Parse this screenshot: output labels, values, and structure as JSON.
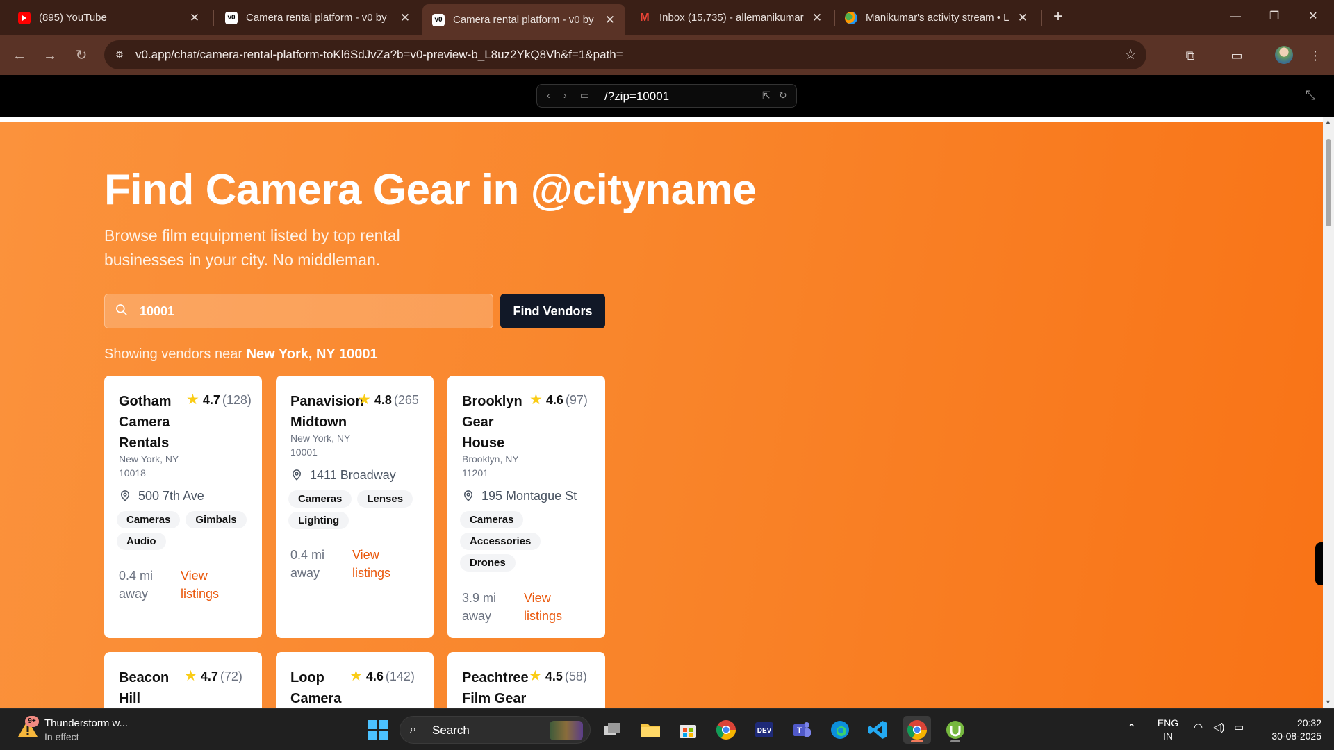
{
  "browser": {
    "tabs": [
      {
        "label": "(895) YouTube",
        "favicon": "youtube-icon"
      },
      {
        "label": "Camera rental platform - v0 by",
        "favicon": "v0-icon"
      },
      {
        "label": "Camera rental platform - v0 by",
        "favicon": "v0-icon",
        "active": true
      },
      {
        "label": "Inbox (15,735) - allemanikumar",
        "favicon": "gmail-icon"
      },
      {
        "label": "Manikumar's activity stream • L",
        "favicon": "linkedin-learning-icon"
      }
    ],
    "new_tab": "+",
    "url": "v0.app/chat/camera-rental-platform-toKl6SdJvZa?b=v0-preview-b_L8uz2YkQ8Vh&f=1&path="
  },
  "preview": {
    "path": "/?zip=10001"
  },
  "page": {
    "title": "Find Camera Gear in @cityname",
    "subtitle": "Browse film equipment listed by top rental businesses in your city. No middleman.",
    "search": {
      "value": "10001"
    },
    "find_button": "Find Vendors",
    "showing_prefix": "Showing vendors near",
    "showing_location": "New York, NY 10001",
    "vendors": [
      {
        "name": "Gotham Camera Rentals",
        "rating": "4.7",
        "reviews": "(128)",
        "location": "New York, NY 10018",
        "address": "500 7th Ave",
        "tags": [
          "Cameras",
          "Gimbals",
          "Audio"
        ],
        "distance": "0.4 mi away",
        "link": "View listings"
      },
      {
        "name": "Panavision Midtown",
        "rating": "4.8",
        "reviews": "(265",
        "location": "New York, NY 10001",
        "address": "1411 Broadway",
        "tags": [
          "Cameras",
          "Lenses",
          "Lighting"
        ],
        "distance": "0.4 mi away",
        "link": "View listings"
      },
      {
        "name": "Brooklyn Gear House",
        "rating": "4.6",
        "reviews": "(97)",
        "location": "Brooklyn, NY 11201",
        "address": "195 Montague St",
        "tags": [
          "Cameras",
          "Accessories",
          "Drones"
        ],
        "distance": "3.9 mi away",
        "link": "View listings"
      },
      {
        "name": "Beacon Hill",
        "rating": "4.7",
        "reviews": "(72)"
      },
      {
        "name": "Loop Camera",
        "rating": "4.6",
        "reviews": "(142)"
      },
      {
        "name": "Peachtree Film Gear",
        "rating": "4.5",
        "reviews": "(58)"
      }
    ],
    "help_button_icon": "help-chat-icon"
  },
  "taskbar": {
    "weather_title": "Thunderstorm w...",
    "weather_sub": "In effect",
    "weather_badge": "9+",
    "search_placeholder": "Search",
    "lang_top": "ENG",
    "lang_bottom": "IN",
    "time": "20:32",
    "date": "30-08-2025"
  },
  "colors": {
    "hero_start": "#fb923c",
    "hero_end": "#f97316",
    "button_dark": "#111827",
    "link_orange": "#ea580c",
    "star": "#facc15"
  }
}
